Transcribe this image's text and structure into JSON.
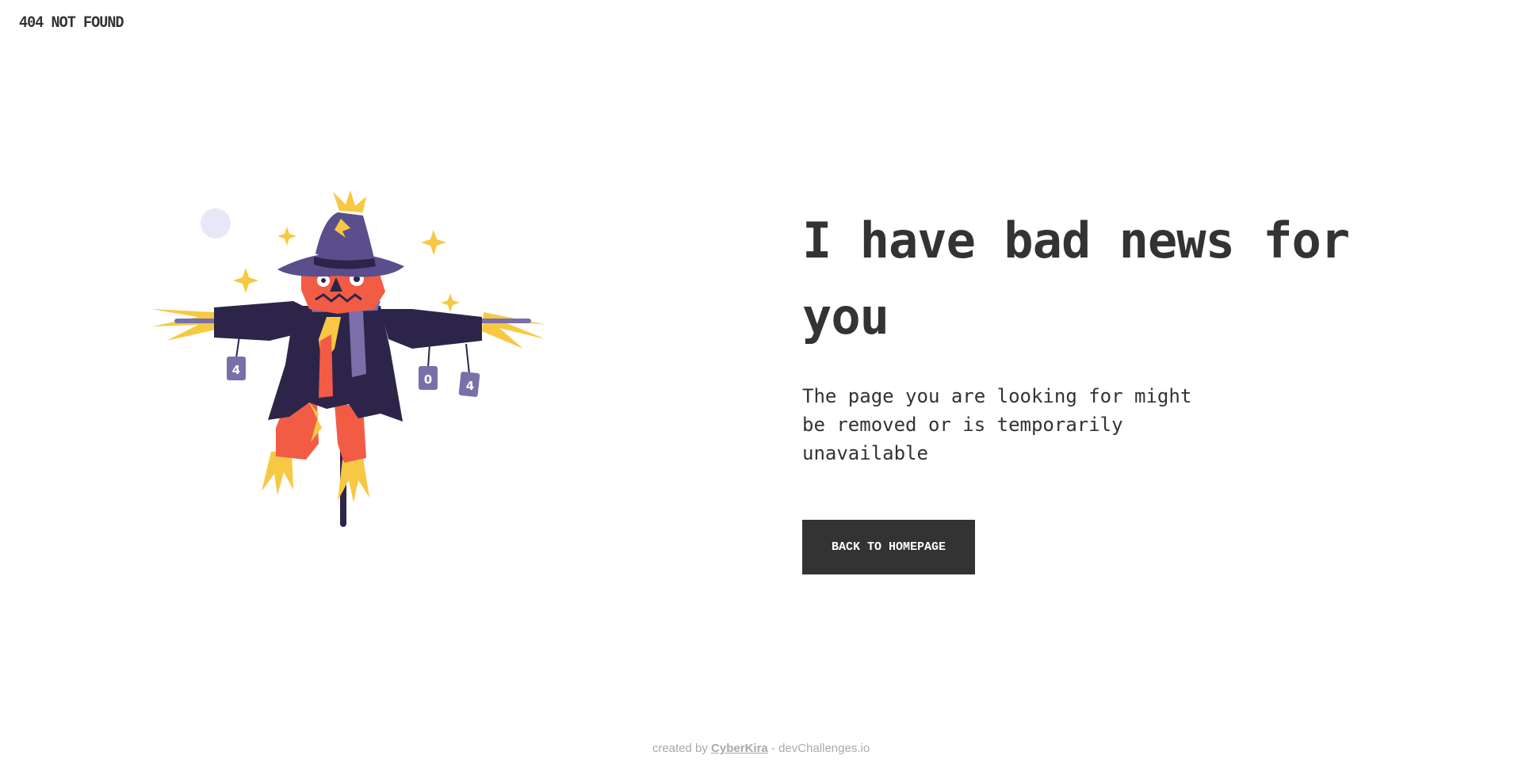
{
  "header": {
    "brand": "404 NOT FOUND"
  },
  "illustration": {
    "description_icon": "scarecrow-illustration",
    "cans": [
      "4",
      "0",
      "4"
    ]
  },
  "main": {
    "headline": "I have bad news for you",
    "message": "The page you are looking for might be removed or is temporarily unavailable",
    "button_label": "BACK TO HOMEPAGE"
  },
  "footer": {
    "prefix": "created by",
    "author": "CyberKira",
    "suffix": "- devChallenges.io"
  },
  "colors": {
    "text": "#333333",
    "button_bg": "#333333",
    "button_text": "#ffffff",
    "footer_text": "#a9a9a9",
    "hat": "#5b4e8c",
    "coat": "#2d2549",
    "face": "#f25c45",
    "straw": "#f7c843",
    "moon": "#e6e9f5"
  }
}
